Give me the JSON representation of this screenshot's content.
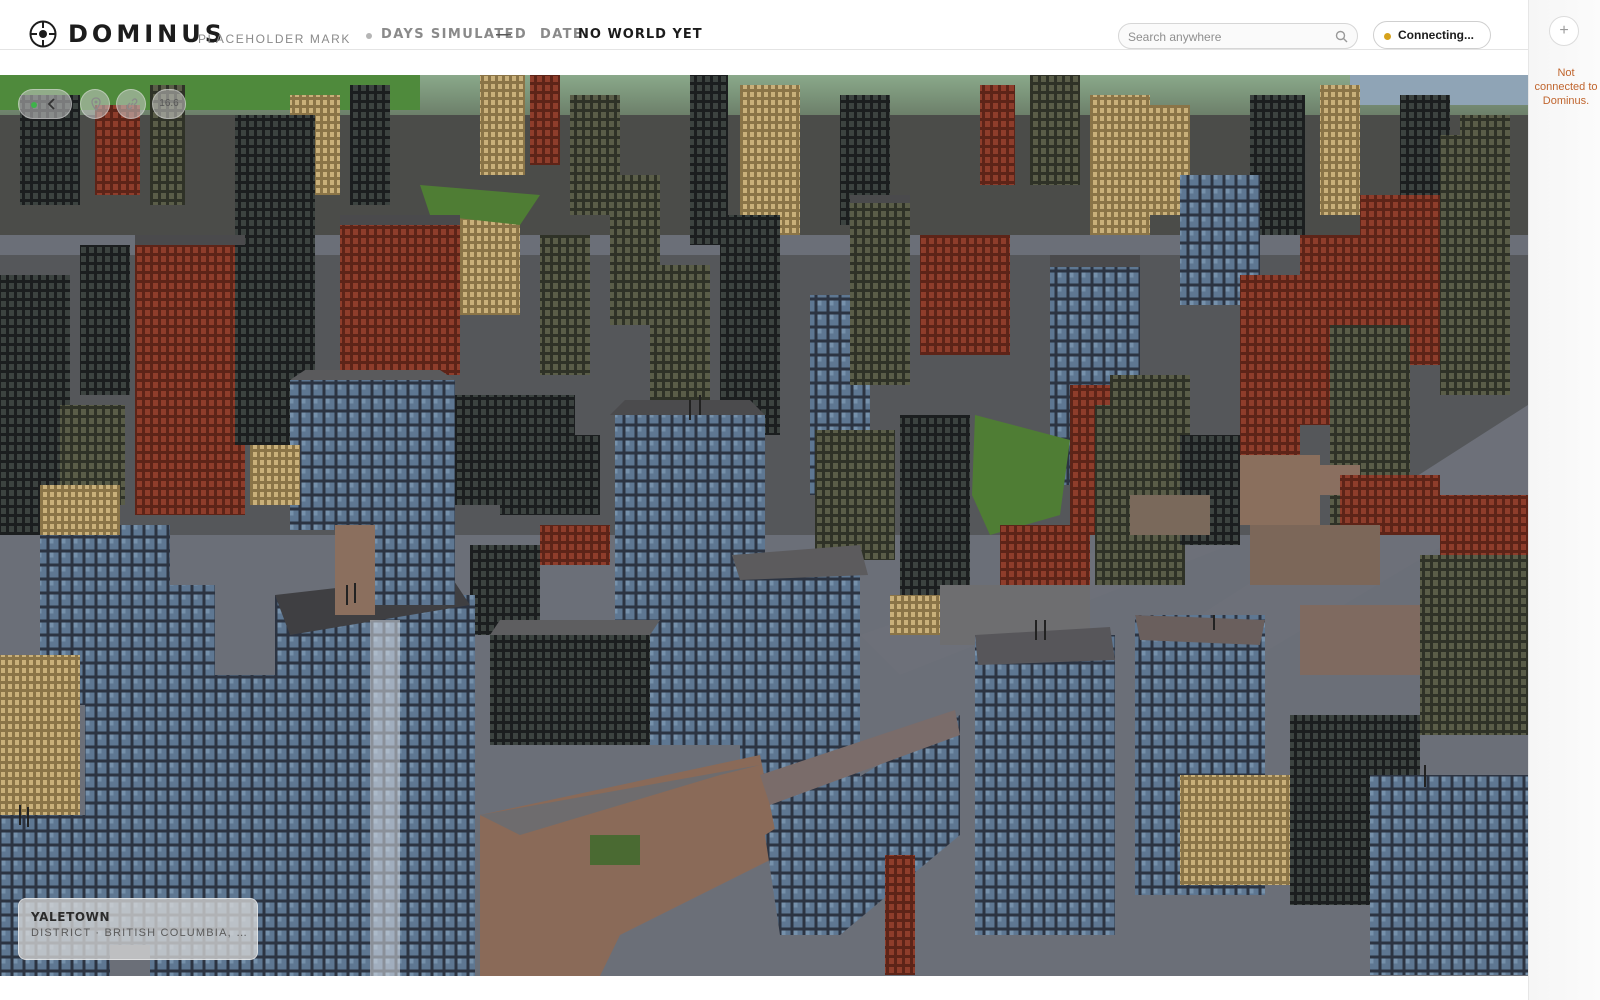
{
  "header": {
    "brand": "DOMINUS",
    "placeholder_mark": "PLACEHOLDER MARK",
    "days_label": "DAYS SIMULATED",
    "days_value": "—",
    "date_label": "DATE",
    "date_value": "NO WORLD YET"
  },
  "search": {
    "placeholder": "Search anywhere",
    "icon": "search-icon"
  },
  "connection": {
    "label": "Connecting...",
    "status_color": "#d6a21c"
  },
  "right_panel": {
    "add_label": "+",
    "status_message": "Not connected to Dominus."
  },
  "map_controls": {
    "back_icon": "chevron-left-icon",
    "pin_icon": "map-pin-icon",
    "link_icon": "link-icon",
    "zoom_value": "16.6"
  },
  "location": {
    "name": "YALETOWN",
    "subtitle": "DISTRICT · BRITISH COLUMBIA, CA..."
  },
  "colors": {
    "accent": "#d6a21c",
    "warning_text": "#c0652e",
    "online": "#3fb24a"
  }
}
